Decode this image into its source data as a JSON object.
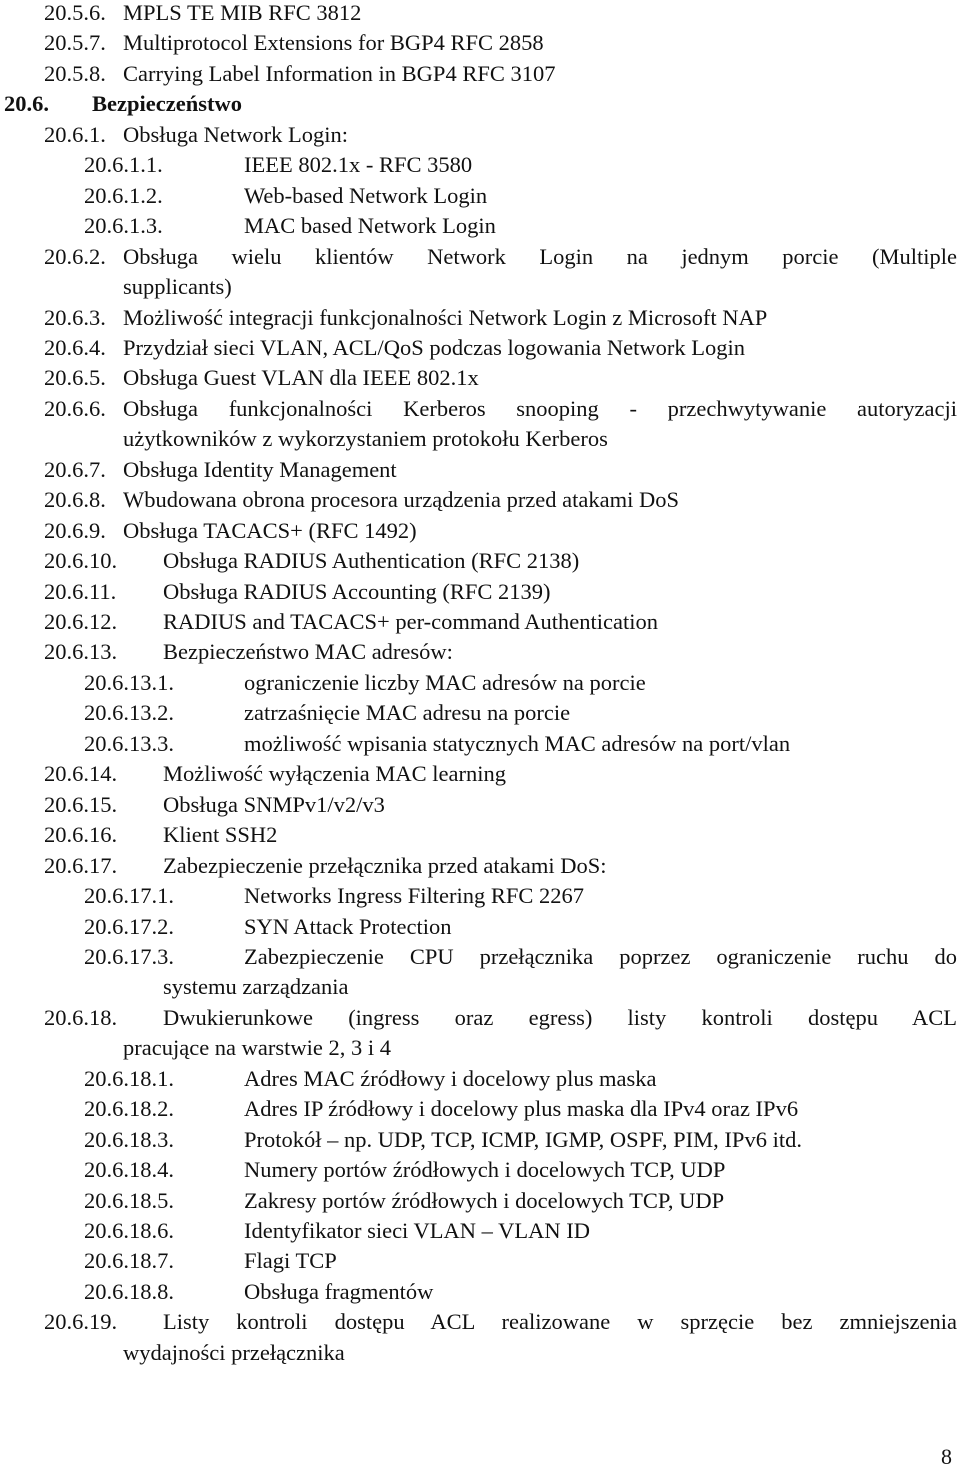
{
  "document": {
    "lines": [
      {
        "num": "20.5.6.",
        "text": "MPLS TE MIB RFC 3812"
      },
      {
        "num": "20.5.7.",
        "text": "Multiprotocol Extensions for BGP4 RFC 2858"
      },
      {
        "num": "20.5.8.",
        "text": "Carrying Label Information in BGP4 RFC 3107"
      },
      {
        "num": "20.6.",
        "text": "Bezpieczeństwo"
      },
      {
        "num": "20.6.1.",
        "text": "Obsługa Network Login:"
      },
      {
        "num": "20.6.1.1.",
        "text": "IEEE 802.1x - RFC 3580"
      },
      {
        "num": "20.6.1.2.",
        "text": "Web-based Network Login"
      },
      {
        "num": "20.6.1.3.",
        "text": "MAC based Network Login"
      },
      {
        "num": "20.6.2.",
        "text": "Obsługa wielu klientów Network Login na jednym porcie (Multiple"
      },
      {
        "num": "",
        "text": "supplicants)"
      },
      {
        "num": "20.6.3.",
        "text": "Możliwość integracji funkcjonalności Network Login z Microsoft NAP"
      },
      {
        "num": "20.6.4.",
        "text": "Przydział sieci VLAN, ACL/QoS podczas logowania Network Login"
      },
      {
        "num": "20.6.5.",
        "text": "Obsługa Guest VLAN dla IEEE 802.1x"
      },
      {
        "num": "20.6.6.",
        "text": "Obsługa funkcjonalności Kerberos snooping - przechwytywanie autoryzacji"
      },
      {
        "num": "",
        "text": "użytkowników z wykorzystaniem protokołu Kerberos"
      },
      {
        "num": "20.6.7.",
        "text": "Obsługa Identity Management"
      },
      {
        "num": "20.6.8.",
        "text": "Wbudowana obrona procesora urządzenia przed atakami DoS"
      },
      {
        "num": "20.6.9.",
        "text": "Obsługa TACACS+ (RFC 1492)"
      },
      {
        "num": "20.6.10.",
        "text": "Obsługa RADIUS Authentication (RFC 2138)"
      },
      {
        "num": "20.6.11.",
        "text": "Obsługa RADIUS Accounting (RFC 2139)"
      },
      {
        "num": "20.6.12.",
        "text": "RADIUS and TACACS+ per-command Authentication"
      },
      {
        "num": "20.6.13.",
        "text": "Bezpieczeństwo MAC adresów:"
      },
      {
        "num": "20.6.13.1.",
        "text": "ograniczenie liczby MAC adresów na porcie"
      },
      {
        "num": "20.6.13.2.",
        "text": "zatrzaśnięcie MAC adresu na porcie"
      },
      {
        "num": "20.6.13.3.",
        "text": "możliwość wpisania statycznych MAC adresów na port/vlan"
      },
      {
        "num": "20.6.14.",
        "text": "Możliwość wyłączenia MAC learning"
      },
      {
        "num": "20.6.15.",
        "text": "Obsługa SNMPv1/v2/v3"
      },
      {
        "num": "20.6.16.",
        "text": "Klient SSH2"
      },
      {
        "num": "20.6.17.",
        "text": "Zabezpieczenie przełącznika przed atakami DoS:"
      },
      {
        "num": "20.6.17.1.",
        "text": "Networks Ingress Filtering RFC 2267"
      },
      {
        "num": "20.6.17.2.",
        "text": "SYN Attack Protection"
      },
      {
        "num": "20.6.17.3.",
        "text": "Zabezpieczenie CPU przełącznika poprzez ograniczenie ruchu do"
      },
      {
        "num": "",
        "text": "systemu zarządzania"
      },
      {
        "num": "20.6.18.",
        "text": "Dwukierunkowe (ingress oraz egress) listy kontroli dostępu ACL"
      },
      {
        "num": "",
        "text": "pracujące na warstwie 2, 3 i 4"
      },
      {
        "num": "20.6.18.1.",
        "text": "Adres MAC źródłowy i docelowy plus maska"
      },
      {
        "num": "20.6.18.2.",
        "text": "Adres IP źródłowy i docelowy plus maska dla IPv4 oraz IPv6"
      },
      {
        "num": "20.6.18.3.",
        "text": "Protokół – np. UDP, TCP, ICMP, IGMP, OSPF, PIM, IPv6 itd."
      },
      {
        "num": "20.6.18.4.",
        "text": "Numery portów źródłowych i docelowych TCP, UDP"
      },
      {
        "num": "20.6.18.5.",
        "text": "Zakresy portów źródłowych i docelowych TCP, UDP"
      },
      {
        "num": "20.6.18.6.",
        "text": "Identyfikator sieci VLAN – VLAN ID"
      },
      {
        "num": "20.6.18.7.",
        "text": "Flagi TCP"
      },
      {
        "num": "20.6.18.8.",
        "text": "Obsługa fragmentów"
      },
      {
        "num": "20.6.19.",
        "text": "Listy kontroli dostępu ACL realizowane w sprzęcie bez zmniejszenia"
      },
      {
        "num": "",
        "text": "wydajności przełącznika"
      }
    ],
    "page_number": "8"
  }
}
